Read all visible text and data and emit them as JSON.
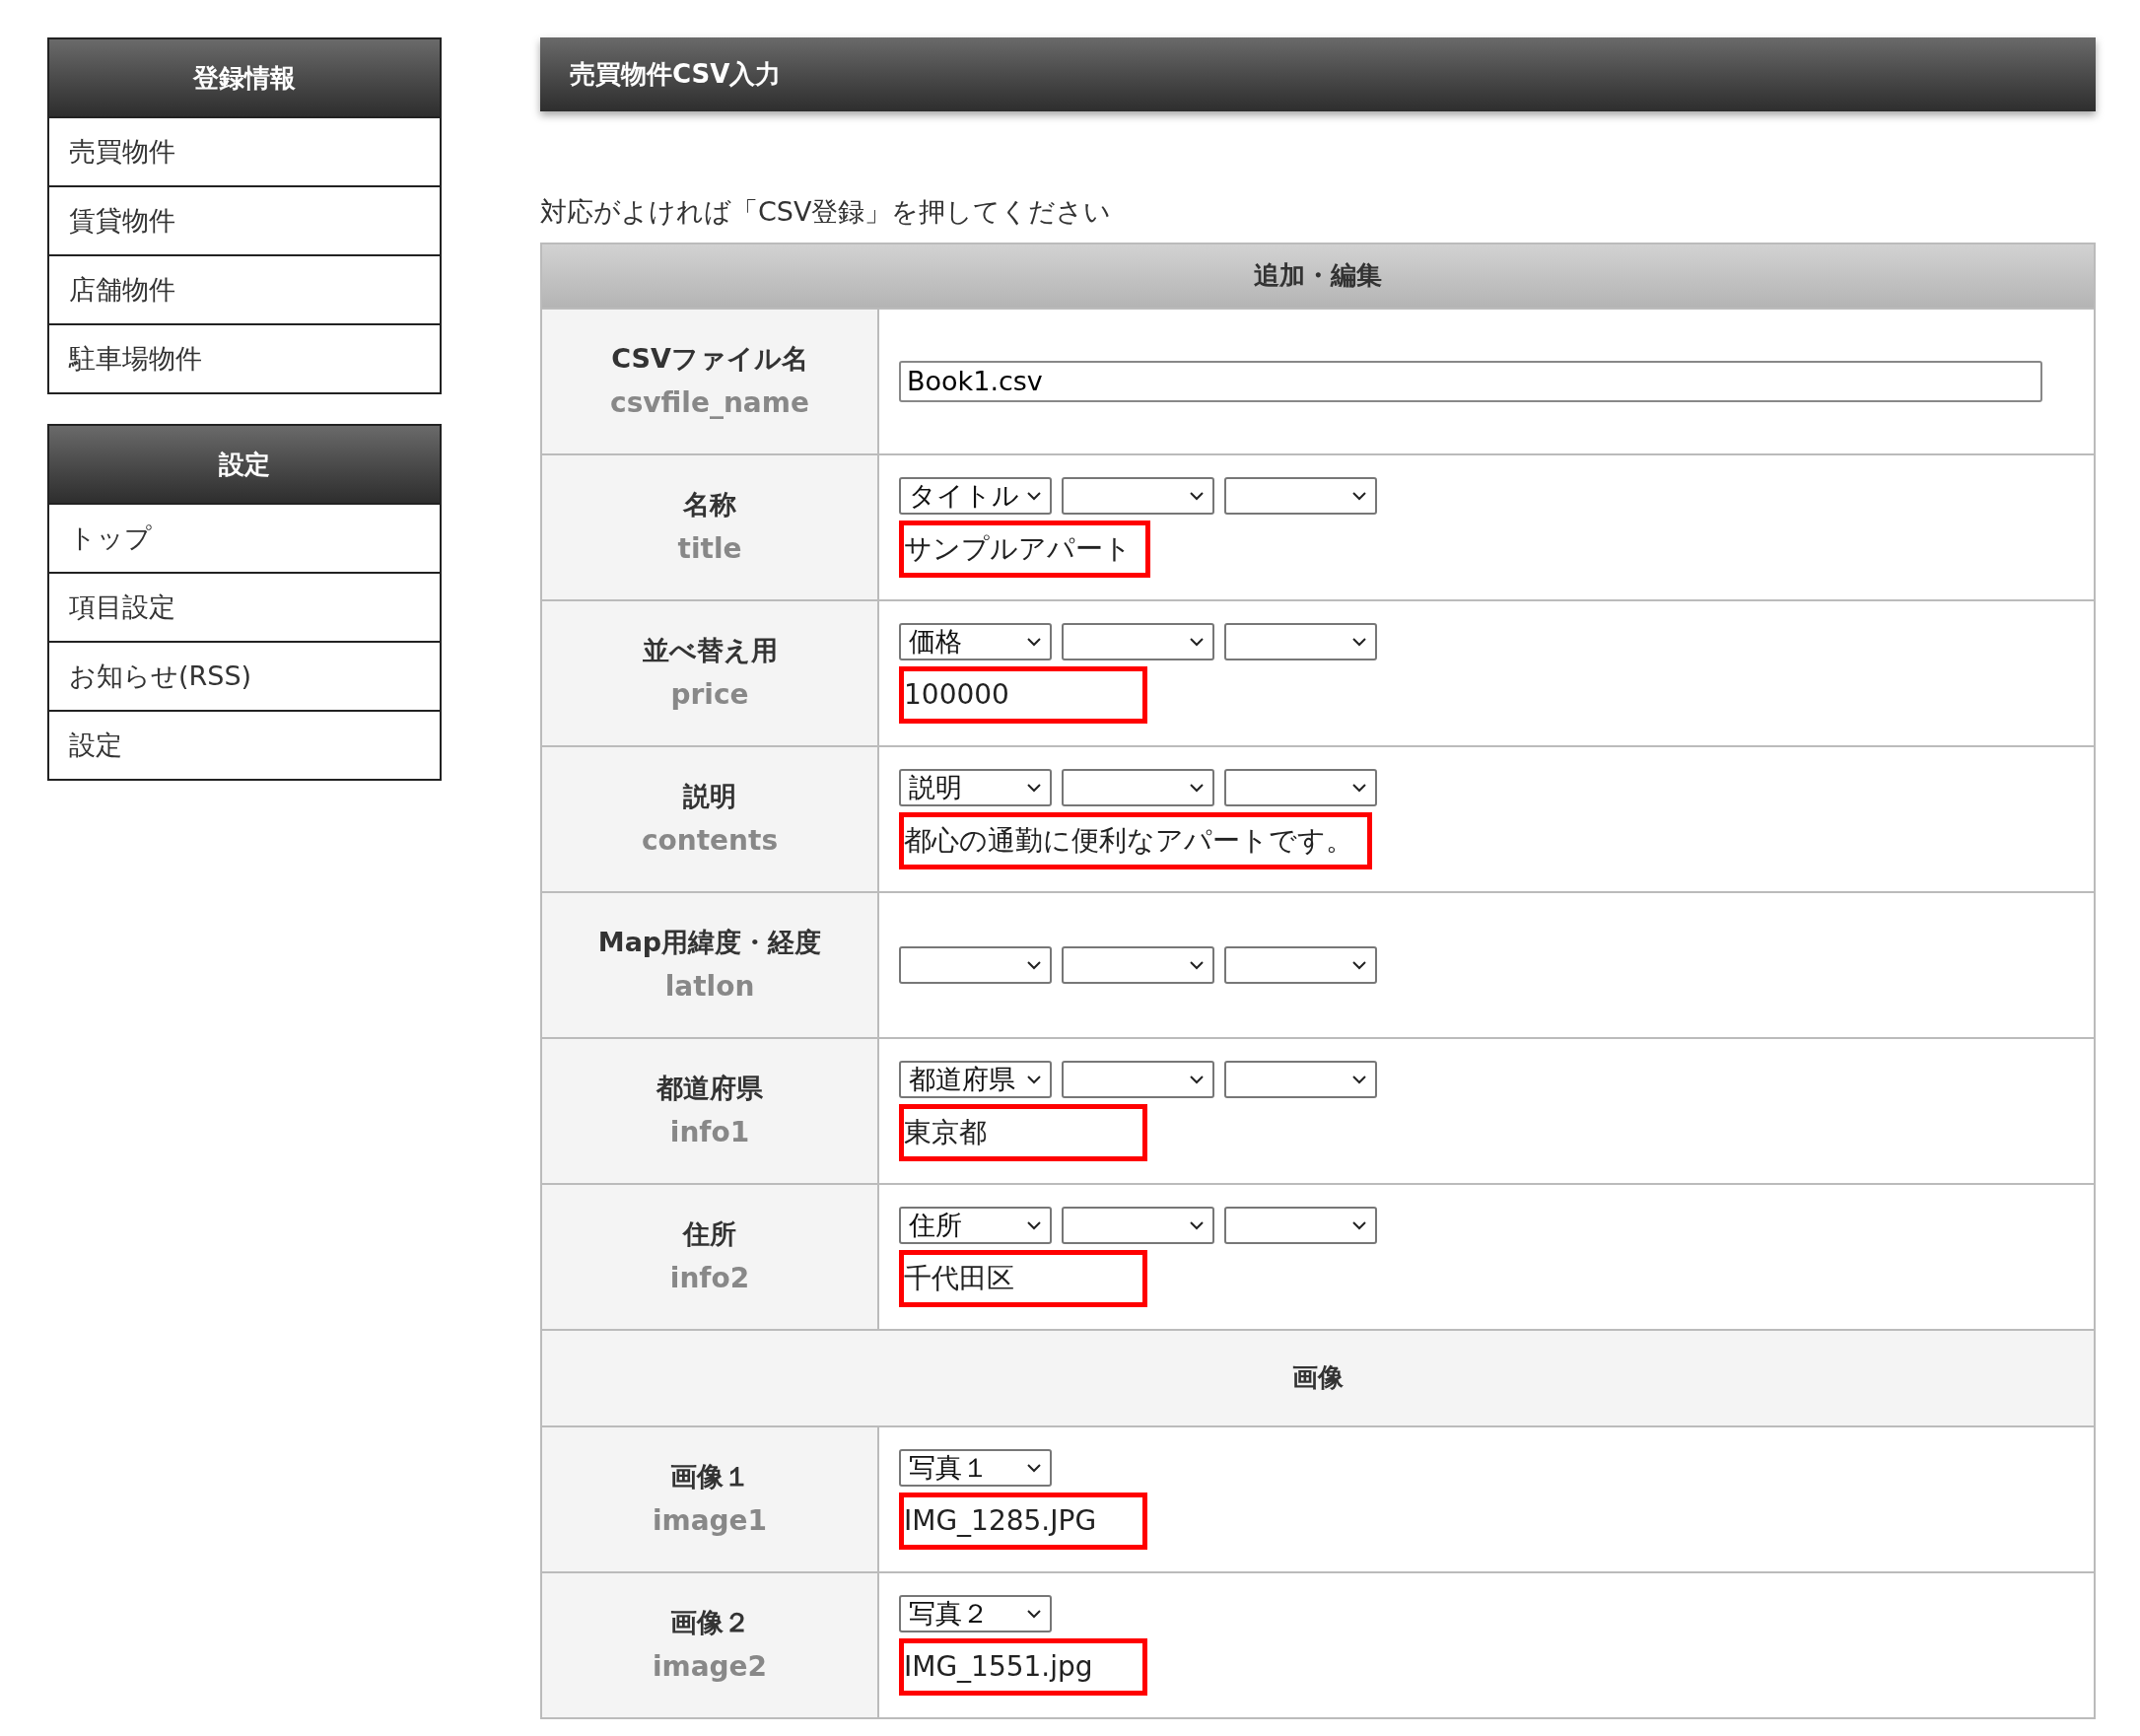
{
  "sidebar": {
    "sections": [
      {
        "title": "登録情報",
        "items": [
          "売買物件",
          "賃貸物件",
          "店舗物件",
          "駐車場物件"
        ]
      },
      {
        "title": "設定",
        "items": [
          "トップ",
          "項目設定",
          "お知らせ(RSS)",
          "設定"
        ]
      }
    ]
  },
  "main": {
    "title": "売買物件CSV入力",
    "instruction": "対応がよければ「CSV登録」を押してください",
    "table": {
      "heading": "追加・編集",
      "rows": [
        {
          "kind": "file",
          "label": "CSVファイル名",
          "key": "csvfile_name",
          "value": "Book1.csv"
        },
        {
          "kind": "mapping",
          "label": "名称",
          "key": "title",
          "selects": [
            {
              "kind": "filled",
              "value": "タイトル"
            },
            {
              "kind": "empty"
            },
            {
              "kind": "empty"
            }
          ],
          "value": "サンプルアパート"
        },
        {
          "kind": "mapping",
          "label": "並べ替え用",
          "key": "price",
          "selects": [
            {
              "kind": "filled",
              "value": "価格"
            },
            {
              "kind": "empty"
            },
            {
              "kind": "empty"
            }
          ],
          "value": "100000"
        },
        {
          "kind": "mapping",
          "label": "説明",
          "key": "contents",
          "selects": [
            {
              "kind": "filled",
              "value": "説明"
            },
            {
              "kind": "empty"
            },
            {
              "kind": "empty"
            }
          ],
          "value": "都心の通勤に便利なアパートです。"
        },
        {
          "kind": "mapping",
          "label": "Map用緯度・経度",
          "key": "latlon",
          "selects": [
            {
              "kind": "empty"
            },
            {
              "kind": "empty"
            },
            {
              "kind": "empty"
            }
          ]
        },
        {
          "kind": "mapping",
          "label": "都道府県",
          "key": "info1",
          "selects": [
            {
              "kind": "filled",
              "value": "都道府県"
            },
            {
              "kind": "empty"
            },
            {
              "kind": "empty"
            }
          ],
          "value": "東京都"
        },
        {
          "kind": "mapping",
          "label": "住所",
          "key": "info2",
          "selects": [
            {
              "kind": "filled",
              "value": "住所"
            },
            {
              "kind": "empty"
            },
            {
              "kind": "empty"
            }
          ],
          "value": "千代田区"
        },
        {
          "kind": "section",
          "label": "画像"
        },
        {
          "kind": "mapping",
          "label": "画像１",
          "key": "image1",
          "selects": [
            {
              "kind": "filled",
              "value": "写真１"
            }
          ],
          "value": "IMG_1285.JPG"
        },
        {
          "kind": "mapping",
          "label": "画像２",
          "key": "image2",
          "selects": [
            {
              "kind": "filled",
              "value": "写真２"
            }
          ],
          "value": "IMG_1551.jpg"
        }
      ]
    }
  }
}
